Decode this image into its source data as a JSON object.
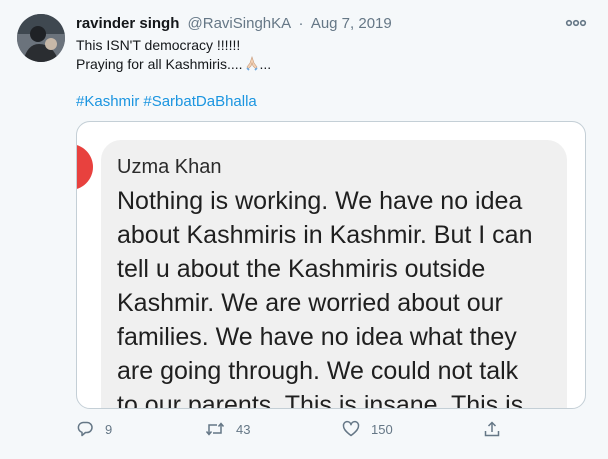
{
  "tweet": {
    "author": {
      "display_name": "ravinder singh",
      "handle": "@RaviSinghKA",
      "separator": "·",
      "date": "Aug 7, 2019",
      "avatar_icon": "user-avatar"
    },
    "text_lines": [
      "This ISN'T democracy !!!!!!",
      "Praying for all Kashmiris...."
    ],
    "text_trailing": "...",
    "hashtags": [
      "#Kashmir",
      "#SarbatDaBhalla"
    ],
    "media": {
      "sender": "Uzma Khan",
      "message_lines": [
        "Nothing is working. We have no idea",
        "about Kashmiris in Kashmir. But I can",
        "tell u about the Kashmiris outside",
        "Kashmir. We are worried about our",
        "families. We have no idea what they",
        "are going through. We could not talk",
        "to our parents. This is insane. This is"
      ]
    },
    "actions": {
      "reply_count": "9",
      "retweet_count": "43",
      "like_count": "150"
    },
    "colors": {
      "background": "#f5f8fa",
      "link": "#1b95e0",
      "muted": "#657786",
      "accent_red": "#e8413e"
    }
  }
}
